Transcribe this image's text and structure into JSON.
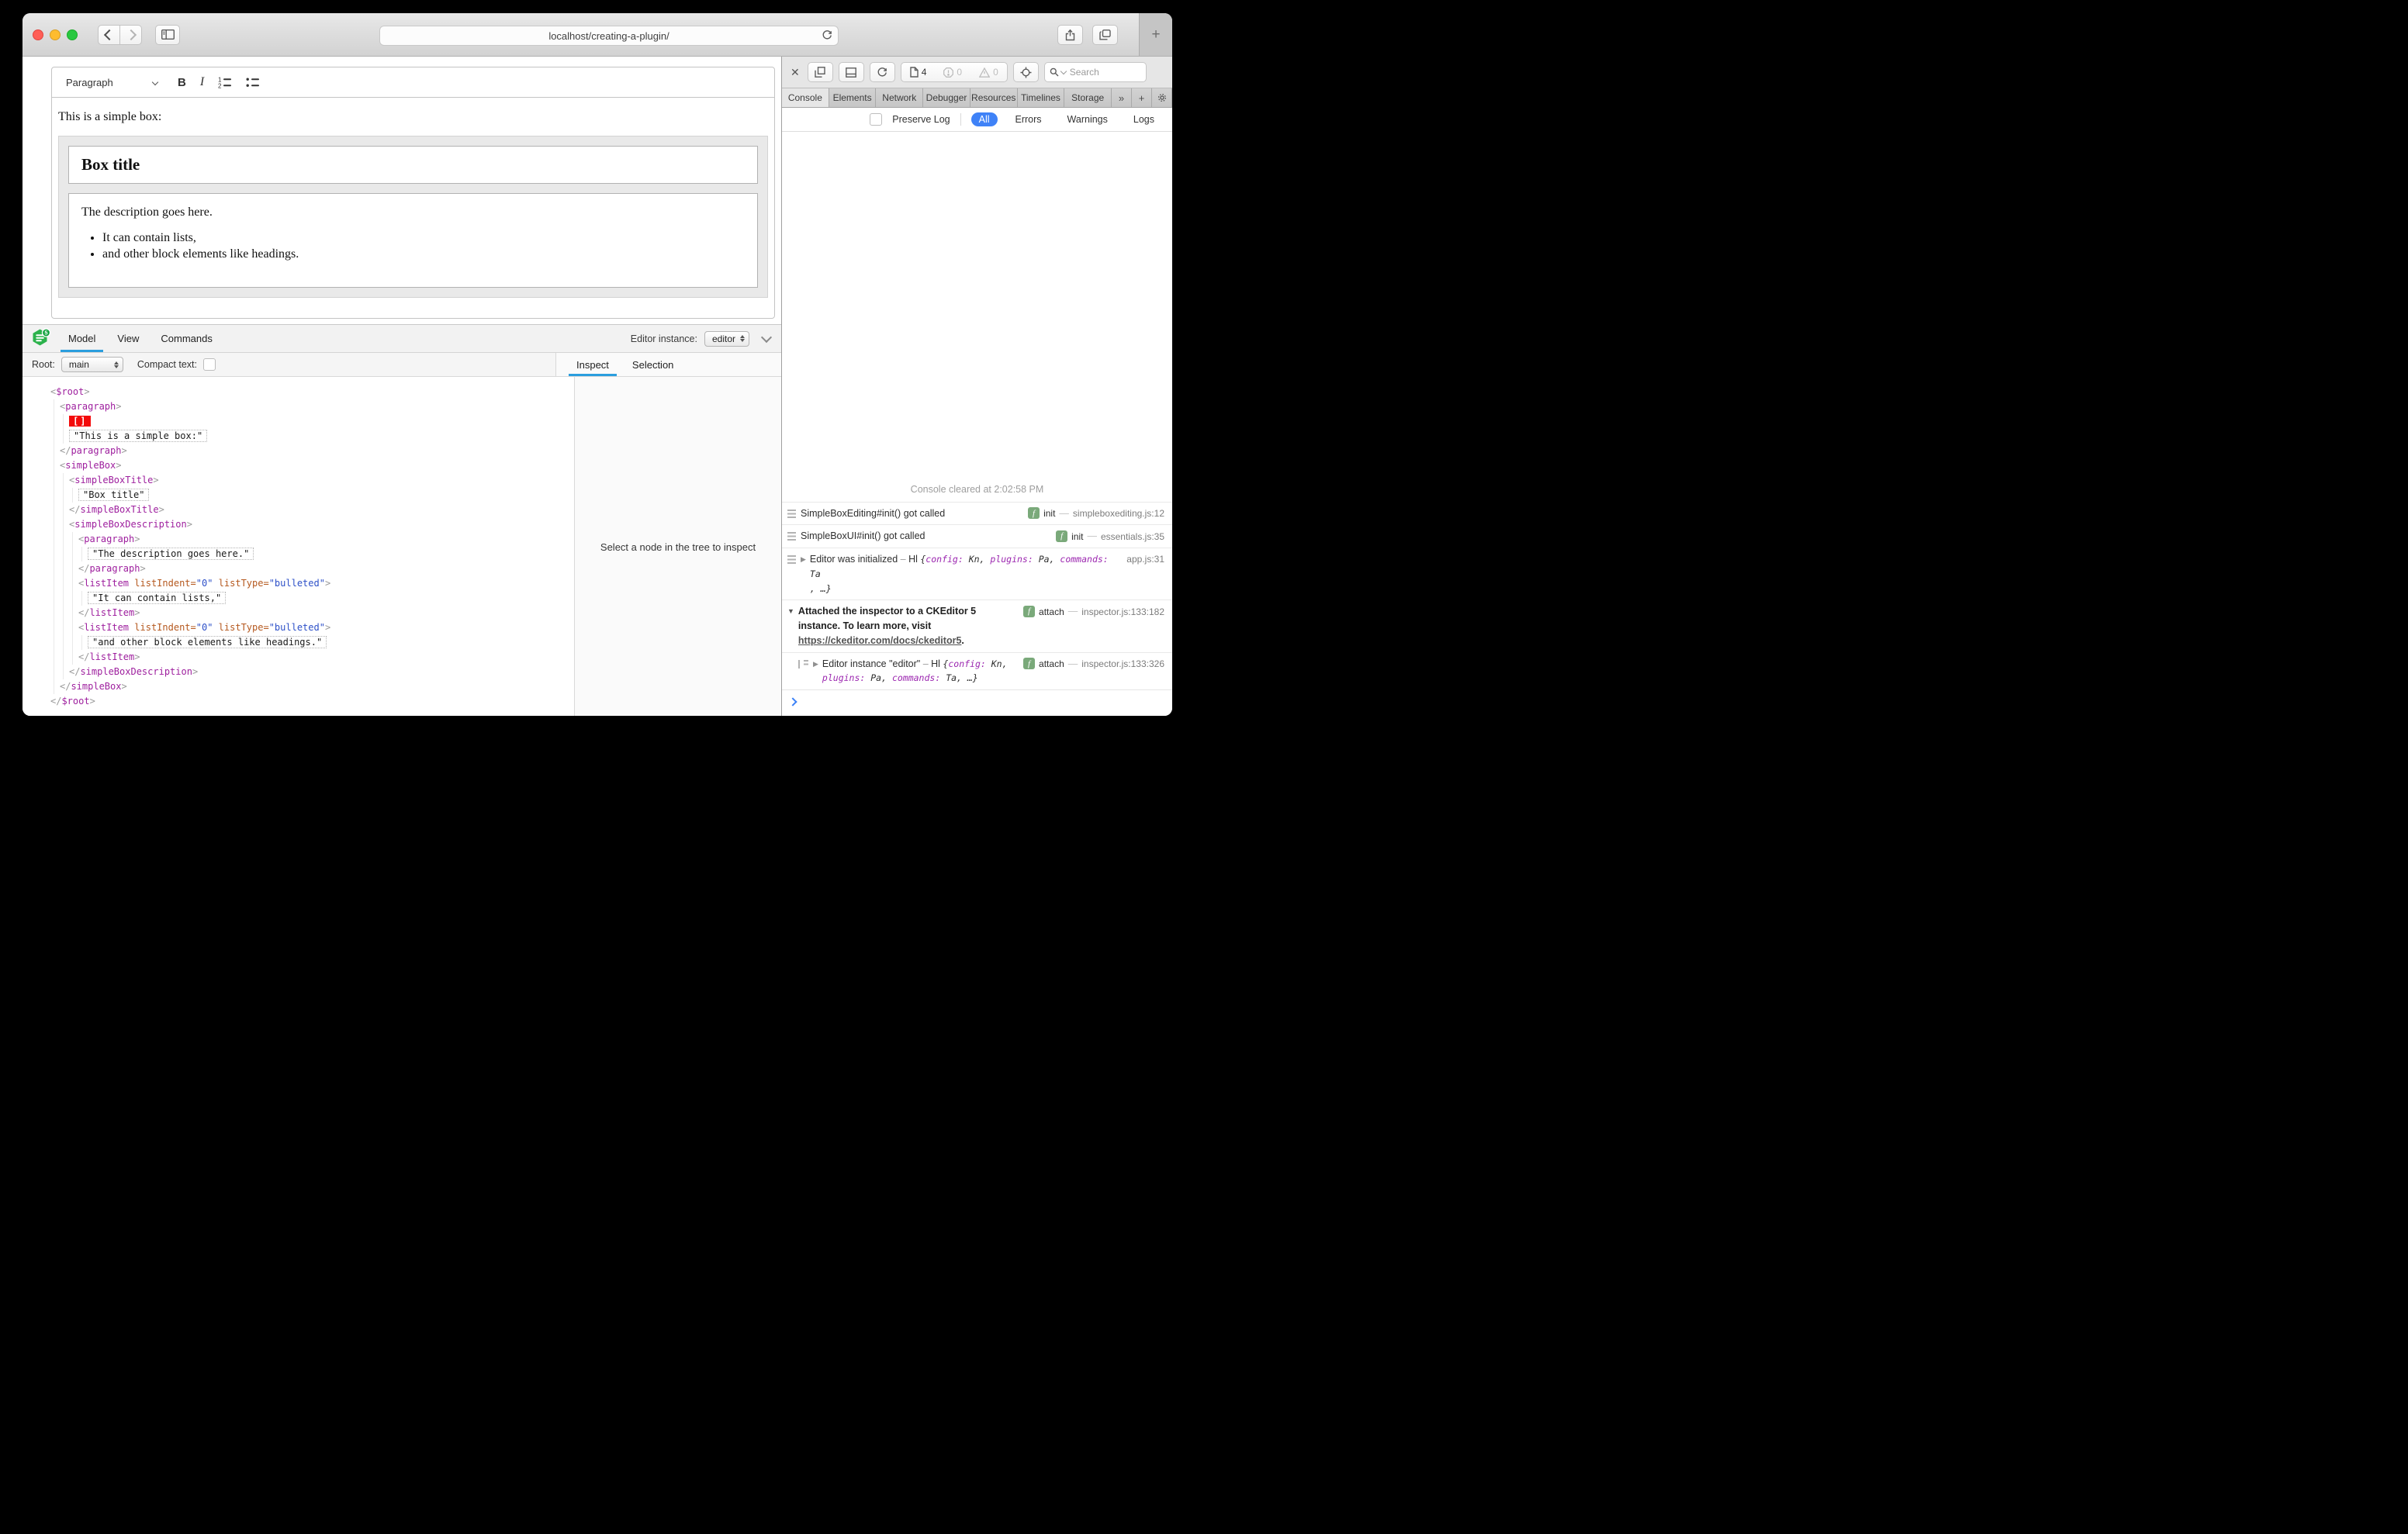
{
  "browser": {
    "url": "localhost/creating-a-plugin/",
    "new_tab_label": "+",
    "icons": [
      "back-icon",
      "forward-icon",
      "sidebar-icon",
      "reload-icon",
      "share-icon",
      "tab-overview-icon",
      "plus-icon"
    ]
  },
  "editor": {
    "toolbar": {
      "paragraph_dropdown": "Paragraph",
      "bold_label": "B",
      "italic_label": "I",
      "icons": [
        "numbered-list-icon",
        "bulleted-list-icon"
      ]
    },
    "content": {
      "intro": "This is a simple box:",
      "box_title": "Box title",
      "description": "The description goes here.",
      "list": [
        "It can contain lists,",
        "and other block elements like headings."
      ]
    }
  },
  "inspector": {
    "tabs": [
      {
        "label": "Model",
        "active": true
      },
      {
        "label": "View",
        "active": false
      },
      {
        "label": "Commands",
        "active": false
      }
    ],
    "editor_instance_label": "Editor instance:",
    "editor_instance_value": "editor",
    "root_label": "Root:",
    "root_value": "main",
    "compact_text_label": "Compact text:",
    "right_tabs": [
      {
        "label": "Inspect",
        "active": true
      },
      {
        "label": "Selection",
        "active": false
      }
    ],
    "empty_state": "Select a node in the tree to inspect",
    "selection_marker": "[]",
    "accent_color": "#2b9ede",
    "tree": {
      "tag": "$root",
      "children": [
        {
          "tag": "paragraph",
          "children": [
            {
              "selection": true
            },
            {
              "text": "\"This is a simple box:\""
            }
          ]
        },
        {
          "tag": "simpleBox",
          "children": [
            {
              "tag": "simpleBoxTitle",
              "children": [
                {
                  "text": "\"Box title\""
                }
              ]
            },
            {
              "tag": "simpleBoxDescription",
              "children": [
                {
                  "tag": "paragraph",
                  "children": [
                    {
                      "text": "\"The description goes here.\""
                    }
                  ]
                },
                {
                  "tag": "listItem",
                  "attrs": [
                    [
                      "listIndent",
                      "\"0\""
                    ],
                    [
                      "listType",
                      "\"bulleted\""
                    ]
                  ],
                  "children": [
                    {
                      "text": "\"It can contain lists,\""
                    }
                  ]
                },
                {
                  "tag": "listItem",
                  "attrs": [
                    [
                      "listIndent",
                      "\"0\""
                    ],
                    [
                      "listType",
                      "\"bulleted\""
                    ]
                  ],
                  "children": [
                    {
                      "text": "\"and other block elements like headings.\""
                    }
                  ]
                }
              ]
            }
          ]
        }
      ]
    }
  },
  "devtools": {
    "close_label": "✕",
    "page_count": "4",
    "error_count": "0",
    "warning_count": "0",
    "search_placeholder": "Search",
    "toolbar_icons": [
      "close-icon",
      "copy-icon",
      "dock-bottom-icon",
      "reload-icon",
      "page-icon",
      "error-badge-icon",
      "warning-badge-icon",
      "element-picker-icon",
      "search-icon"
    ],
    "tabs": [
      {
        "label": "Console",
        "active": true
      },
      {
        "label": "Elements",
        "active": false
      },
      {
        "label": "Network",
        "active": false
      },
      {
        "label": "Debugger",
        "active": false
      },
      {
        "label": "Resources",
        "active": false
      },
      {
        "label": "Timelines",
        "active": false
      },
      {
        "label": "Storage",
        "active": false
      }
    ],
    "more_tabs_label": "»",
    "add_tab_label": "+",
    "filter": {
      "preserve_log": "Preserve Log",
      "buttons": [
        {
          "label": "All",
          "active": true
        },
        {
          "label": "Errors",
          "active": false
        },
        {
          "label": "Warnings",
          "active": false
        },
        {
          "label": "Logs",
          "active": false
        }
      ],
      "active_color": "#3f82f7"
    },
    "console": {
      "cleared": "Console cleared at 2:02:58 PM",
      "rows": [
        {
          "icon": "log",
          "msg": [
            {
              "s": "plain",
              "v": "SimpleBoxEditing#init() got called"
            }
          ],
          "fn": "init",
          "file": "simpleboxediting.js:12"
        },
        {
          "icon": "log",
          "msg": [
            {
              "s": "plain",
              "v": "SimpleBoxUI#init() got called"
            }
          ],
          "fn": "init",
          "file": "essentials.js:35"
        },
        {
          "icon": "log",
          "disc": "right",
          "msg": [
            {
              "s": "plain",
              "v": "Editor was initialized"
            },
            {
              "s": "dim",
              "v": " – "
            },
            {
              "s": "plain",
              "v": "Hl "
            },
            {
              "s": "val",
              "v": "{"
            },
            {
              "s": "key",
              "v": "config: "
            },
            {
              "s": "val",
              "v": "Kn, "
            },
            {
              "s": "key",
              "v": "plugins: "
            },
            {
              "s": "val",
              "v": "Pa, "
            },
            {
              "s": "key",
              "v": "commands: "
            },
            {
              "s": "val",
              "v": "Ta"
            },
            {
              "s": "br"
            },
            {
              "s": "val",
              "v": ", …}"
            }
          ],
          "fn": null,
          "file": "app.js:31"
        },
        {
          "disc": "down",
          "bold": true,
          "msg": [
            {
              "s": "plain",
              "v": "Attached the inspector to a CKEditor 5"
            },
            {
              "s": "br"
            },
            {
              "s": "plain",
              "v": "instance. To learn more, visit"
            },
            {
              "s": "br"
            },
            {
              "s": "link",
              "v": "https://ckeditor.com/docs/ckeditor5"
            },
            {
              "s": "plain",
              "v": "."
            }
          ],
          "fn": "attach",
          "file": "inspector.js:133:182"
        },
        {
          "icon": "nest",
          "nested": true,
          "disc": "right",
          "msg": [
            {
              "s": "plain",
              "v": "Editor instance \"editor\""
            },
            {
              "s": "dim",
              "v": " – "
            },
            {
              "s": "plain",
              "v": "Hl "
            },
            {
              "s": "val",
              "v": "{"
            },
            {
              "s": "key",
              "v": "config: "
            },
            {
              "s": "val",
              "v": "Kn,"
            },
            {
              "s": "br"
            },
            {
              "s": "key",
              "v": "plugins: "
            },
            {
              "s": "val",
              "v": "Pa, "
            },
            {
              "s": "key",
              "v": "commands: "
            },
            {
              "s": "val",
              "v": "Ta, …}"
            }
          ],
          "fn": "attach",
          "file": "inspector.js:133:326"
        }
      ]
    }
  }
}
